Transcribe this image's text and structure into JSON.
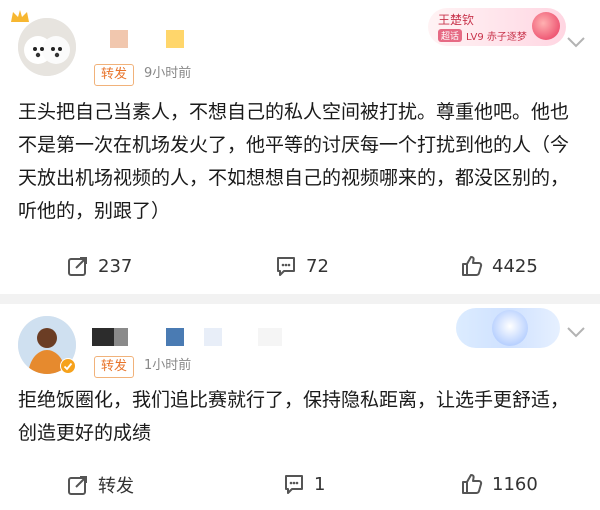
{
  "post1": {
    "tag": "转发",
    "time": "9小时前",
    "text": "王头把自己当素人，不想自己的私人空间被打扰。尊重他吧。他也不是第一次在机场发火了，他平等的讨厌每一个打扰到他的人（今天放出机场视频的人，不如想想自己的视频哪来的，都没区别的，听他的，别跟了）",
    "badge": {
      "name": "王楚钦",
      "tag": "超话",
      "level": "LV9 赤子逐梦"
    },
    "actions": {
      "repost": "237",
      "comment": "72",
      "like": "4425"
    },
    "icons": {
      "repost": "share-icon",
      "comment": "comment-icon",
      "like": "thumbs-up-icon",
      "more": "chevron-down-icon"
    }
  },
  "post2": {
    "tag": "转发",
    "time": "1小时前",
    "text": "拒绝饭圈化，我们追比赛就行了，保持隐私距离，让选手更舒适，创造更好的成绩",
    "actions": {
      "repost": "转发",
      "comment": "1",
      "like": "1160"
    },
    "icons": {
      "repost": "share-icon",
      "comment": "comment-icon",
      "like": "thumbs-up-icon",
      "more": "chevron-down-icon"
    }
  },
  "colors": {
    "tag": "#e8742b",
    "separator": "#f2f2f2",
    "badge_pink": "#c8334b"
  }
}
